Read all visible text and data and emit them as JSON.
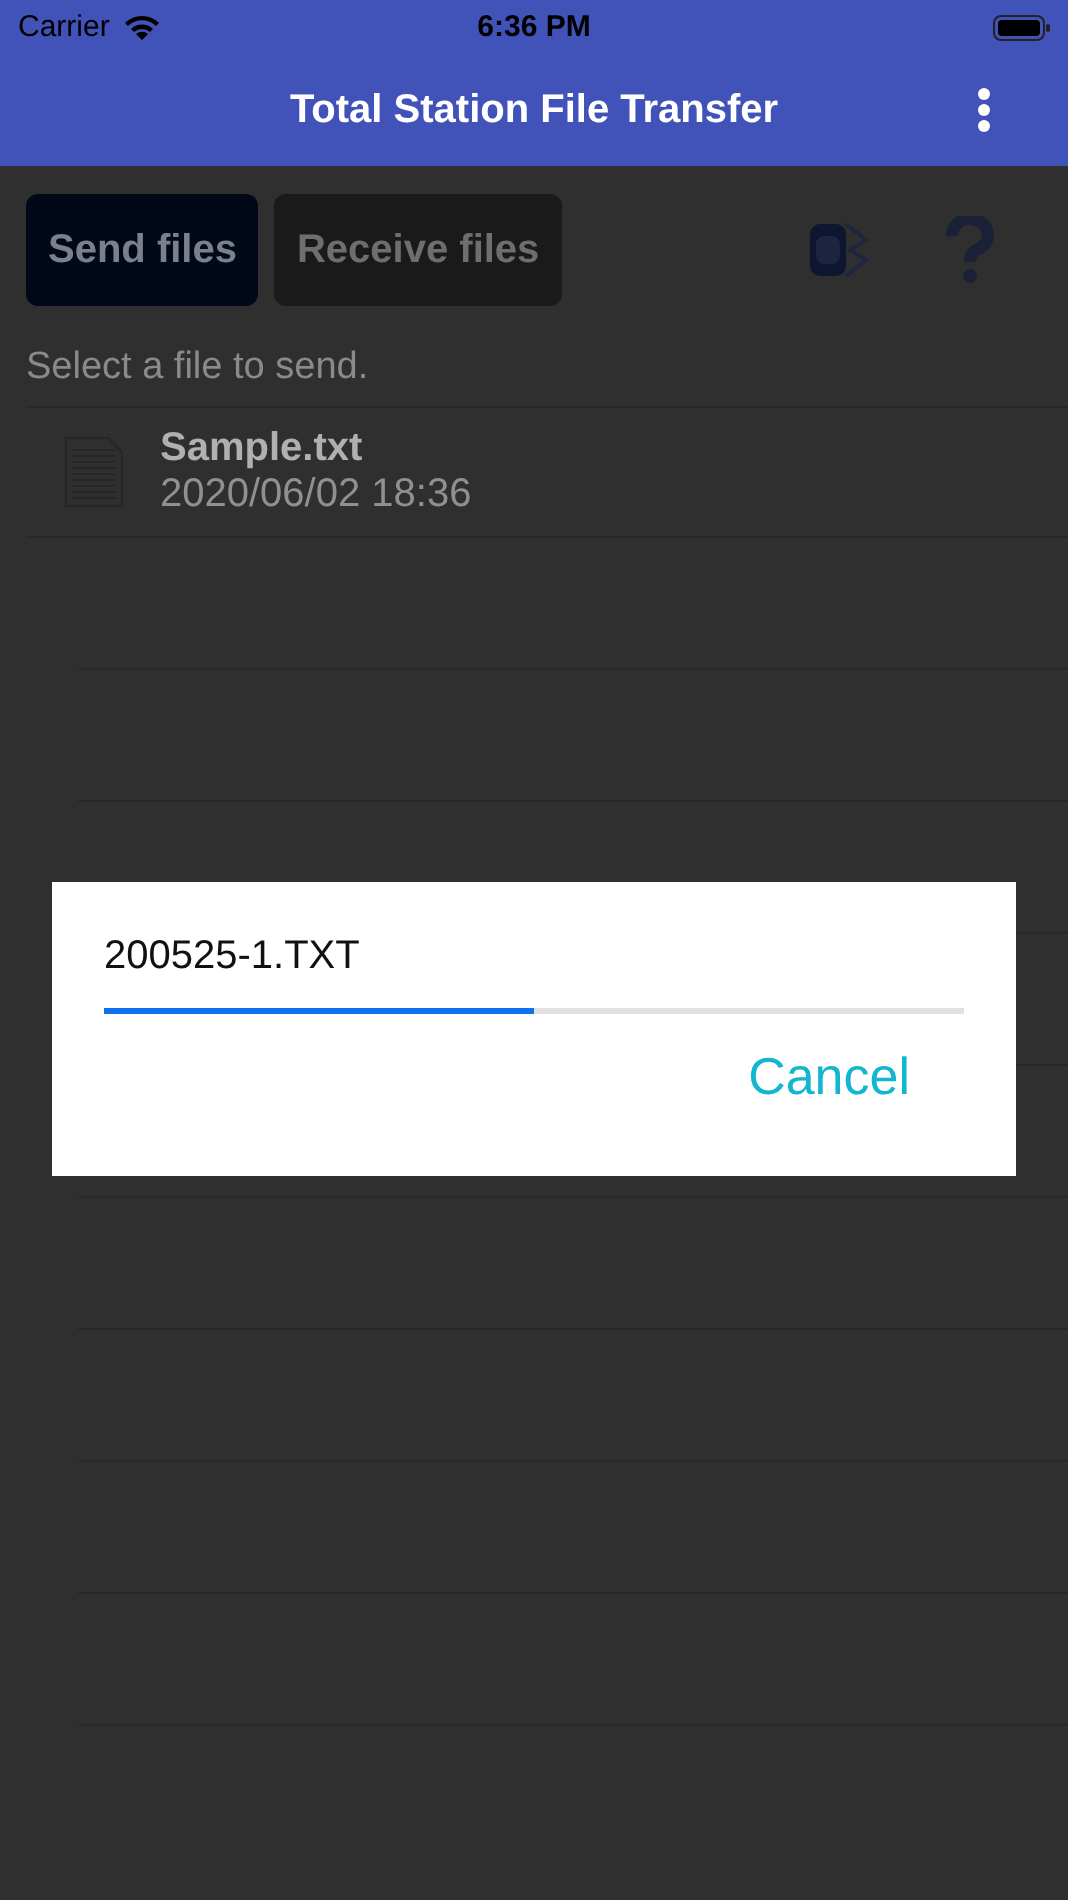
{
  "status_bar": {
    "carrier": "Carrier",
    "time": "6:36 PM"
  },
  "nav_bar": {
    "title": "Total Station File Transfer"
  },
  "tabs": [
    {
      "label": "Send files",
      "selected": true
    },
    {
      "label": "Receive files",
      "selected": false
    }
  ],
  "instruction": "Select a file to send.",
  "files": [
    {
      "name": "Sample.txt",
      "date": "2020/06/02 18:36"
    }
  ],
  "dialog": {
    "file_name": "200525-1.TXT",
    "level": 0.5,
    "button": "Cancel"
  }
}
